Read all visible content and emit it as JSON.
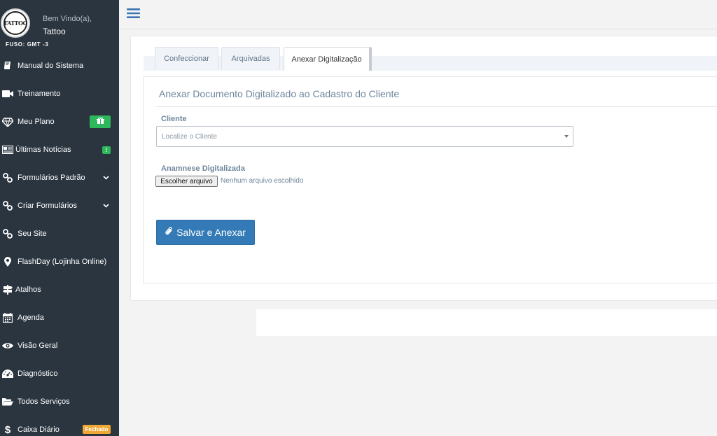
{
  "sidebar": {
    "logo_text": "TATTOO",
    "welcome": "Bem Vindo(a),",
    "username": "Tattoo",
    "timezone": "FUSO: GMT -3",
    "items": [
      {
        "label": "Manual do Sistema",
        "icon": "book-icon"
      },
      {
        "label": "Treinamento",
        "icon": "video-camera-icon"
      },
      {
        "label": "Meu Plano",
        "icon": "diamond-icon",
        "badge_icon": "gift-icon"
      },
      {
        "label": "Últimas Notícias",
        "icon": "newspaper-icon",
        "badge": "!"
      },
      {
        "label": "Formulários Padrão",
        "icon": "link-icon",
        "expand_icon": "chevron-down-icon"
      },
      {
        "label": "Criar Formulários",
        "icon": "link-icon",
        "expand_icon": "chevron-down-icon"
      },
      {
        "label": "Seu Site",
        "icon": "link-icon"
      },
      {
        "label": "FlashDay (Lojinha Online)",
        "icon": "map-marker-icon"
      },
      {
        "label": "Atalhos",
        "icon": "signpost-icon"
      },
      {
        "label": "Agenda",
        "icon": "calendar-icon"
      },
      {
        "label": "Visão Geral",
        "icon": "eye-icon"
      },
      {
        "label": "Diagnóstico",
        "icon": "dashboard-icon"
      },
      {
        "label": "Todos Serviços",
        "icon": "folder-open-icon"
      },
      {
        "label": "Caixa Diário",
        "icon": "dollar-icon",
        "badge": "Fechado"
      }
    ]
  },
  "topbar": {
    "menu_icon": "hamburger-icon"
  },
  "tabs": [
    {
      "label": "Confeccionar"
    },
    {
      "label": "Arquivadas"
    },
    {
      "label": "Anexar Digitalização",
      "active": true
    }
  ],
  "form": {
    "title": "Anexar Documento Digitalizado ao Cadastro do Cliente",
    "client_label": "Cliente",
    "client_placeholder": "Localize o Cliente",
    "scan_label": "Anamnese Digitalizada",
    "file_button": "Escolher arquivo",
    "file_status": "Nenhum arquivo escolhido",
    "submit_label": "Salvar e Anexar",
    "submit_icon": "paperclip-icon"
  },
  "colors": {
    "sidebar_bg": "#2a3540",
    "primary": "#337ab7",
    "success": "#2eb85c",
    "warning": "#f0a834",
    "label": "#6e869c"
  }
}
